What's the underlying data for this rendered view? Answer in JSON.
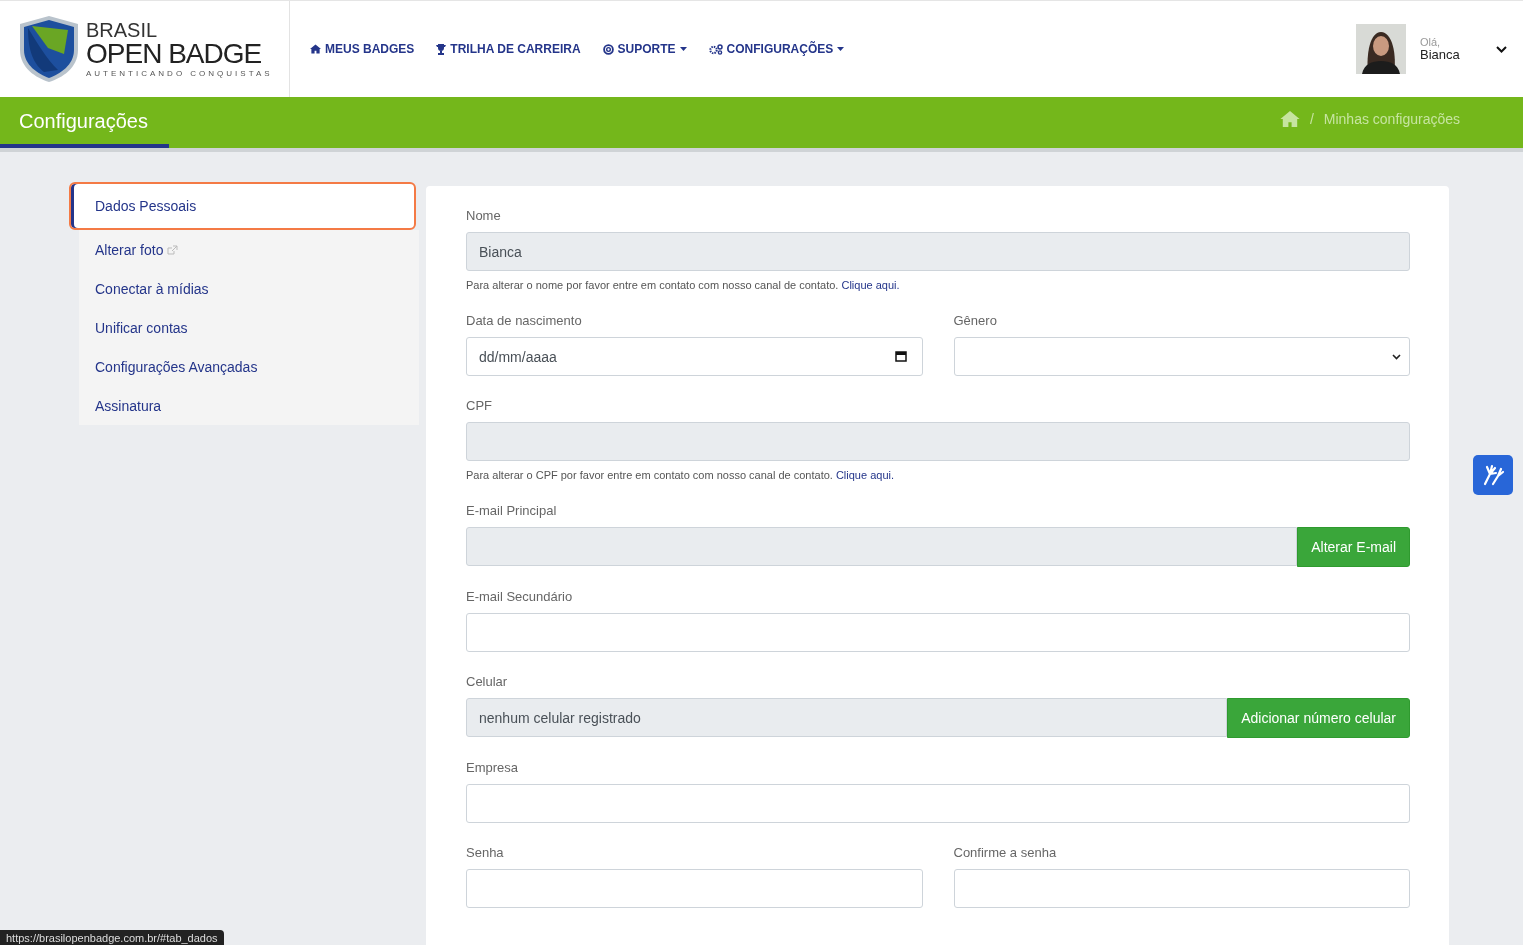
{
  "header": {
    "logo": {
      "line1": "BRASIL",
      "line2": "OPEN BADGE",
      "tagline": "AUTENTICANDO CONQUISTAS"
    },
    "nav": [
      {
        "label": "MEUS BADGES",
        "dropdown": false
      },
      {
        "label": "TRILHA DE CARREIRA",
        "dropdown": false
      },
      {
        "label": "SUPORTE",
        "dropdown": true
      },
      {
        "label": "CONFIGURAÇÕES",
        "dropdown": true
      }
    ],
    "user": {
      "greeting": "Olá,",
      "name": "Bianca"
    }
  },
  "page_header": {
    "title": "Configurações",
    "breadcrumb_separator": "/",
    "breadcrumb": [
      "Minhas configurações"
    ]
  },
  "sidebar": {
    "items": [
      {
        "label": "Dados Pessoais",
        "selected": true,
        "external": false
      },
      {
        "label": "Alterar foto",
        "selected": false,
        "external": true
      },
      {
        "label": "Conectar à mídias",
        "selected": false,
        "external": false
      },
      {
        "label": "Unificar contas",
        "selected": false,
        "external": false
      },
      {
        "label": "Configurações Avançadas",
        "selected": false,
        "external": false
      },
      {
        "label": "Assinatura",
        "selected": false,
        "external": false
      }
    ]
  },
  "form": {
    "rows": [
      {
        "fields": [
          {
            "kind": "text",
            "label": "Nome",
            "value": "Bianca",
            "disabled": true,
            "help": "Para alterar o nome por favor entre em contato com nosso canal de contato.",
            "help_link": "Clique aqui."
          }
        ]
      },
      {
        "fields": [
          {
            "kind": "date",
            "label": "Data de nascimento",
            "placeholder": "dd/mm/aaaa"
          },
          {
            "kind": "select",
            "label": "Gênero"
          }
        ]
      },
      {
        "fields": [
          {
            "kind": "text",
            "label": "CPF",
            "disabled": true,
            "help": "Para alterar o CPF por favor entre em contato com nosso canal de contato.",
            "help_link": "Clique aqui."
          }
        ]
      },
      {
        "fields": [
          {
            "kind": "text",
            "label": "E-mail Principal",
            "disabled": true,
            "button": "Alterar E-mail"
          }
        ]
      },
      {
        "fields": [
          {
            "kind": "text",
            "label": "E-mail Secundário",
            "disabled": false
          }
        ]
      },
      {
        "fields": [
          {
            "kind": "text",
            "label": "Celular",
            "value": "nenhum celular registrado",
            "disabled": true,
            "button": "Adicionar número celular"
          }
        ]
      },
      {
        "fields": [
          {
            "kind": "text",
            "label": "Empresa",
            "disabled": false
          }
        ]
      },
      {
        "fields": [
          {
            "kind": "text",
            "label": "Senha",
            "disabled": false
          },
          {
            "kind": "text",
            "label": "Confirme a senha",
            "disabled": false
          }
        ]
      }
    ]
  },
  "status_url": "https://brasilopenbadge.com.br/#tab_dados"
}
